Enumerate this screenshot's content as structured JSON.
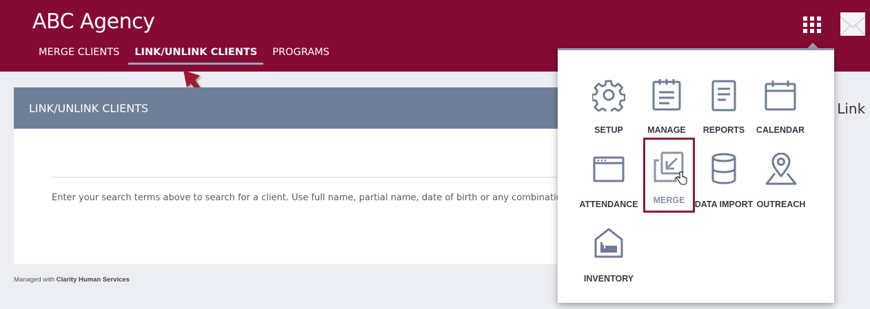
{
  "header": {
    "app_title": "ABC Agency",
    "tabs": [
      {
        "label": "MERGE CLIENTS",
        "active": false
      },
      {
        "label": "LINK/UNLINK CLIENTS",
        "active": true
      },
      {
        "label": "PROGRAMS",
        "active": false
      }
    ],
    "apps_icon": "grid-icon",
    "mail_icon": "mail-icon",
    "brand_color": "#850b35"
  },
  "card": {
    "title": "LINK/UNLINK CLIENTS",
    "hint": "Enter your search terms above to search for a client. Use full name, partial name, date of birth or any combination."
  },
  "partial_text": "t Link",
  "footer": {
    "prefix": "Managed with ",
    "brand": "Clarity Human Services"
  },
  "app_menu": {
    "items": [
      {
        "label": "SETUP",
        "icon": "gear-icon"
      },
      {
        "label": "MANAGE",
        "icon": "clipboard-icon"
      },
      {
        "label": "REPORTS",
        "icon": "document-icon"
      },
      {
        "label": "CALENDAR",
        "icon": "calendar-icon"
      },
      {
        "label": "ATTENDANCE",
        "icon": "window-icon"
      },
      {
        "label": "MERGE",
        "icon": "merge-icon",
        "highlighted": true
      },
      {
        "label": "DATA IMPORT",
        "icon": "database-icon"
      },
      {
        "label": "OUTREACH",
        "icon": "map-pin-icon"
      },
      {
        "label": "INVENTORY",
        "icon": "house-bed-icon"
      }
    ]
  }
}
